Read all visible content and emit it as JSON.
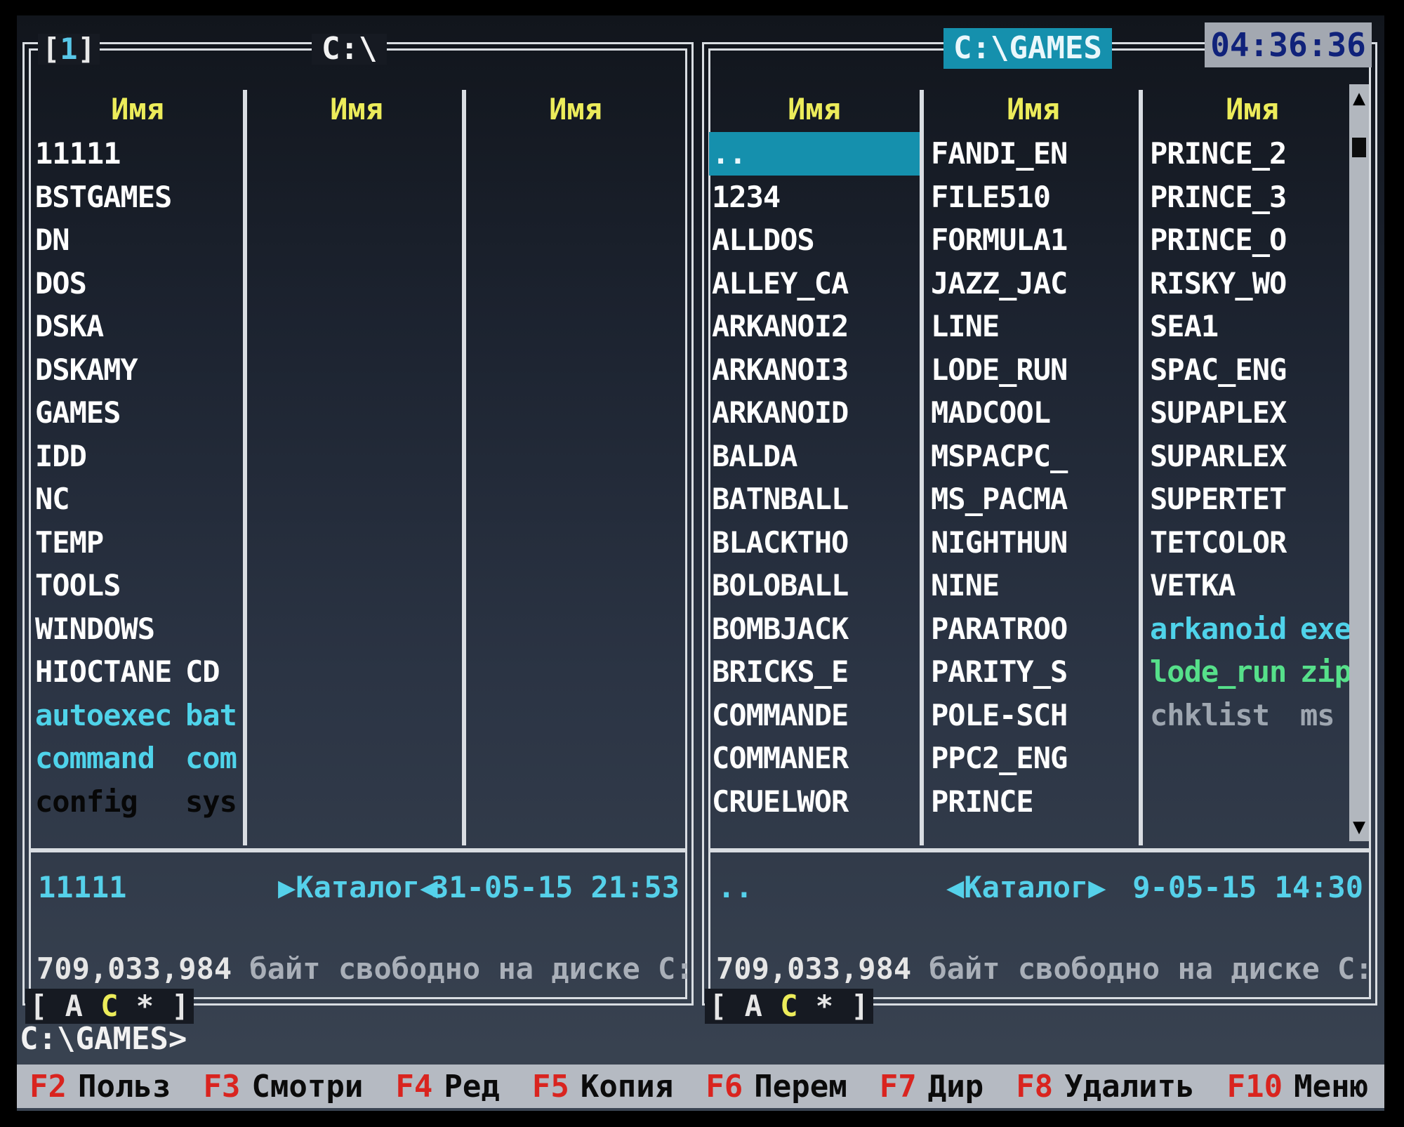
{
  "left_panel": {
    "number": "1",
    "path": "C:\\",
    "column_header": "Имя",
    "columns": [
      [
        {
          "name": "11111",
          "ext": "",
          "kind": "dir"
        },
        {
          "name": "BSTGAMES",
          "ext": "",
          "kind": "dir"
        },
        {
          "name": "DN",
          "ext": "",
          "kind": "dir"
        },
        {
          "name": "DOS",
          "ext": "",
          "kind": "dir"
        },
        {
          "name": "DSKA",
          "ext": "",
          "kind": "dir"
        },
        {
          "name": "DSKAMY",
          "ext": "",
          "kind": "dir"
        },
        {
          "name": "GAMES",
          "ext": "",
          "kind": "dir"
        },
        {
          "name": "IDD",
          "ext": "",
          "kind": "dir"
        },
        {
          "name": "NC",
          "ext": "",
          "kind": "dir"
        },
        {
          "name": "TEMP",
          "ext": "",
          "kind": "dir"
        },
        {
          "name": "TOOLS",
          "ext": "",
          "kind": "dir"
        },
        {
          "name": "WINDOWS",
          "ext": "",
          "kind": "dir"
        },
        {
          "name": "HIOCTANE",
          "ext": "CD",
          "kind": "dir"
        },
        {
          "name": "autoexec",
          "ext": "bat",
          "kind": "exec"
        },
        {
          "name": "command",
          "ext": "com",
          "kind": "exec"
        },
        {
          "name": "config",
          "ext": "sys",
          "kind": "sys"
        }
      ],
      [],
      []
    ],
    "info": {
      "name": "11111",
      "type": "▶Каталог◀",
      "date": "31-05-15 21:53"
    },
    "free": {
      "bytes": "709,033,984",
      "text": " байт свободно на диске C:"
    },
    "drives": {
      "open": "[",
      "a": "A",
      "c": "C",
      "star": "*",
      "close": "]"
    }
  },
  "right_panel": {
    "path": "C:\\GAMES",
    "clock": "04:36:36",
    "column_header": "Имя",
    "columns": [
      [
        {
          "name": "..",
          "ext": "",
          "kind": "cursor"
        },
        {
          "name": "1234",
          "ext": "",
          "kind": "dir"
        },
        {
          "name": "ALLDOS",
          "ext": "",
          "kind": "dir"
        },
        {
          "name": "ALLEY_CA",
          "ext": "",
          "kind": "dir"
        },
        {
          "name": "ARKANOI2",
          "ext": "",
          "kind": "dir"
        },
        {
          "name": "ARKANOI3",
          "ext": "",
          "kind": "dir"
        },
        {
          "name": "ARKANOID",
          "ext": "",
          "kind": "dir"
        },
        {
          "name": "BALDA",
          "ext": "",
          "kind": "dir"
        },
        {
          "name": "BATNBALL",
          "ext": "",
          "kind": "dir"
        },
        {
          "name": "BLACKTHO",
          "ext": "",
          "kind": "dir"
        },
        {
          "name": "BOLOBALL",
          "ext": "",
          "kind": "dir"
        },
        {
          "name": "BOMBJACK",
          "ext": "",
          "kind": "dir"
        },
        {
          "name": "BRICKS_E",
          "ext": "",
          "kind": "dir"
        },
        {
          "name": "COMMANDE",
          "ext": "",
          "kind": "dir"
        },
        {
          "name": "COMMANER",
          "ext": "",
          "kind": "dir"
        },
        {
          "name": "CRUELWOR",
          "ext": "",
          "kind": "dir"
        }
      ],
      [
        {
          "name": "FANDI_EN",
          "ext": "",
          "kind": "dir"
        },
        {
          "name": "FILE510",
          "ext": "",
          "kind": "dir"
        },
        {
          "name": "FORMULA1",
          "ext": "",
          "kind": "dir"
        },
        {
          "name": "JAZZ_JAC",
          "ext": "",
          "kind": "dir"
        },
        {
          "name": "LINE",
          "ext": "",
          "kind": "dir"
        },
        {
          "name": "LODE_RUN",
          "ext": "",
          "kind": "dir"
        },
        {
          "name": "MADCOOL",
          "ext": "",
          "kind": "dir"
        },
        {
          "name": "MSPACPC_",
          "ext": "",
          "kind": "dir"
        },
        {
          "name": "MS_PACMA",
          "ext": "",
          "kind": "dir"
        },
        {
          "name": "NIGHTHUN",
          "ext": "",
          "kind": "dir"
        },
        {
          "name": "NINE",
          "ext": "",
          "kind": "dir"
        },
        {
          "name": "PARATROO",
          "ext": "",
          "kind": "dir"
        },
        {
          "name": "PARITY_S",
          "ext": "",
          "kind": "dir"
        },
        {
          "name": "POLE-SCH",
          "ext": "",
          "kind": "dir"
        },
        {
          "name": "PPC2_ENG",
          "ext": "",
          "kind": "dir"
        },
        {
          "name": "PRINCE",
          "ext": "",
          "kind": "dir"
        }
      ],
      [
        {
          "name": "PRINCE_2",
          "ext": "",
          "kind": "dir"
        },
        {
          "name": "PRINCE_3",
          "ext": "",
          "kind": "dir"
        },
        {
          "name": "PRINCE_O",
          "ext": "",
          "kind": "dir"
        },
        {
          "name": "RISKY_WO",
          "ext": "",
          "kind": "dir"
        },
        {
          "name": "SEA1",
          "ext": "",
          "kind": "dir"
        },
        {
          "name": "SPAC_ENG",
          "ext": "",
          "kind": "dir"
        },
        {
          "name": "SUPAPLEX",
          "ext": "",
          "kind": "dir"
        },
        {
          "name": "SUPARLEX",
          "ext": "",
          "kind": "dir"
        },
        {
          "name": "SUPERTET",
          "ext": "",
          "kind": "dir"
        },
        {
          "name": "TETCOLOR",
          "ext": "",
          "kind": "dir"
        },
        {
          "name": "VETKA",
          "ext": "",
          "kind": "dir"
        },
        {
          "name": "arkanoid",
          "ext": "exe",
          "kind": "exec"
        },
        {
          "name": "lode_run",
          "ext": "zip",
          "kind": "arch"
        },
        {
          "name": "chklist",
          "ext": "ms",
          "kind": "hidden"
        }
      ]
    ],
    "info": {
      "name": "..",
      "type": "◀Каталог▶",
      "date": "9-05-15 14:30"
    },
    "free": {
      "bytes": "709,033,984",
      "text": " байт свободно на диске C:"
    },
    "drives": {
      "open": "[",
      "a": "A",
      "c": "C",
      "star": "*",
      "close": "]"
    },
    "scroll_icons": {
      "up": "arrow-up-icon",
      "down": "arrow-down-icon"
    }
  },
  "command_prompt": "C:\\GAMES>",
  "function_keys": [
    {
      "key": "F2",
      "label": "Польз"
    },
    {
      "key": "F3",
      "label": "Смотри"
    },
    {
      "key": "F4",
      "label": "Ред"
    },
    {
      "key": "F5",
      "label": "Копия"
    },
    {
      "key": "F6",
      "label": "Перем"
    },
    {
      "key": "F7",
      "label": "Дир"
    },
    {
      "key": "F8",
      "label": "Удалить"
    },
    {
      "key": "F10",
      "label": "Меню"
    }
  ],
  "colors": {
    "cursor": "#1590ad",
    "header": "#ecec5a",
    "exec": "#4fd3ea",
    "archive": "#56e08a",
    "fkey_number": "#d9241f",
    "keybar": "#b5bac2"
  }
}
